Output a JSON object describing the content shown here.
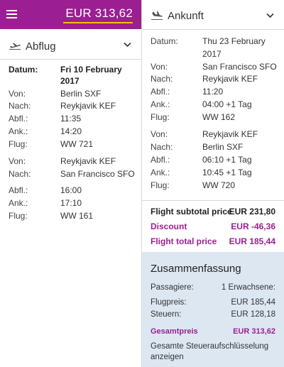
{
  "header": {
    "total_price": "EUR 313,62",
    "accent_color": "#9b1f92",
    "underline_color": "#f2c500"
  },
  "outbound": {
    "title": "Abflug",
    "icon": "plane-takeoff-icon",
    "date_label": "Datum:",
    "date_line1": "Fri 10 February",
    "date_line2": "2017",
    "legs": [
      {
        "from_label": "Von:",
        "from": "Berlin SXF",
        "to_label": "Nach:",
        "to": "Reykjavik KEF",
        "dep_label": "Abfl.:",
        "dep": "11:35",
        "arr_label": "Ank.:",
        "arr": "14:20",
        "flight_label": "Flug:",
        "flight": "WW 721"
      },
      {
        "from_label": "Von:",
        "from": "Reykjavik KEF",
        "to_label": "Nach:",
        "to": "San Francisco SFO",
        "dep_label": "Abfl.:",
        "dep": "16:00",
        "arr_label": "Ank.:",
        "arr": "17:10",
        "flight_label": "Flug:",
        "flight": "WW 161"
      }
    ]
  },
  "inbound": {
    "title": "Ankunft",
    "icon": "plane-landing-icon",
    "date_label": "Datum:",
    "date_line1": "Thu 23 February",
    "date_line2": "2017",
    "legs": [
      {
        "from_label": "Von:",
        "from": "San Francisco SFO",
        "to_label": "Nach:",
        "to": "Reykjavik KEF",
        "dep_label": "Abfl.:",
        "dep": "11:20",
        "arr_label": "Ank.:",
        "arr": "04:00 +1 Tag",
        "flight_label": "Flug:",
        "flight": "WW 162"
      },
      {
        "from_label": "Von:",
        "from": "Reykjavik KEF",
        "to_label": "Nach:",
        "to": "Berlin SXF",
        "dep_label": "Abfl.:",
        "dep": "06:10 +1 Tag",
        "arr_label": "Ank.:",
        "arr": "10:45 +1 Tag",
        "flight_label": "Flug:",
        "flight": "WW 720"
      }
    ]
  },
  "prices": {
    "subtotal_label": "Flight subtotal price",
    "subtotal_value": "EUR 231,80",
    "discount_label": "Discount",
    "discount_value": "EUR -46,36",
    "total_label": "Flight total price",
    "total_value": "EUR 185,44"
  },
  "summary": {
    "title": "Zusammenfassung",
    "passengers_label": "Passagiere:",
    "passengers_value": "1 Erwachsene:",
    "fare_label": "Flugpreis:",
    "fare_value": "EUR 185,44",
    "taxes_label": "Steuern:",
    "taxes_value": "EUR 128,18",
    "total_label": "Gesamtpreis",
    "total_value": "EUR 313,62",
    "note": "Gesamte Steueraufschlüsselung anzeigen"
  }
}
